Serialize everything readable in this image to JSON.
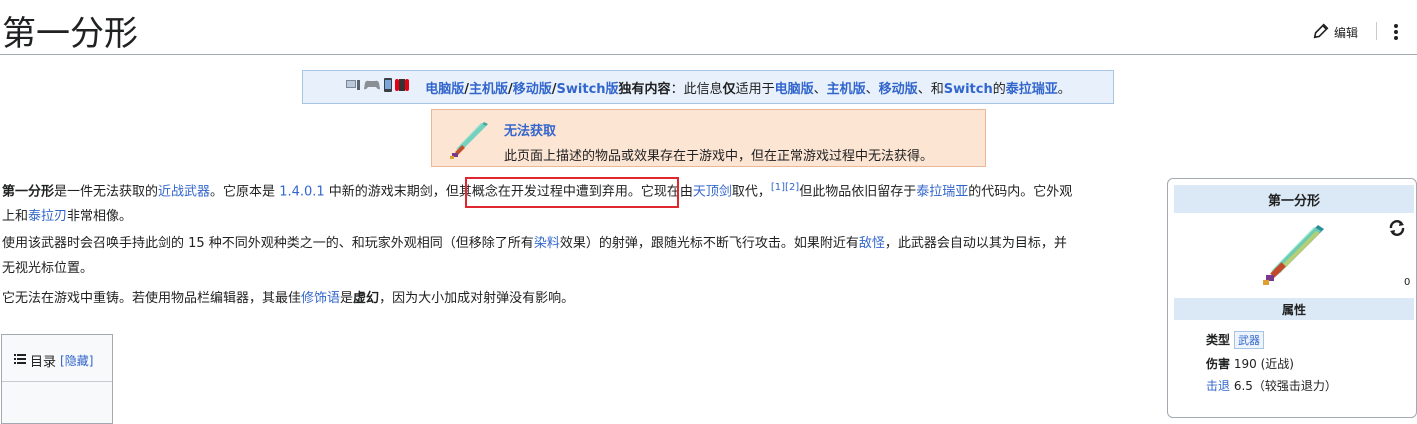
{
  "page": {
    "title": "第一分形",
    "edit_label": "编辑"
  },
  "platform_notice": {
    "pc": "电脑版",
    "console": "主机版",
    "mobile": "移动版",
    "switch": "Switch版",
    "exclusive": "独有内容",
    "text_a": "：此信息",
    "only": "仅",
    "text_b": "适用于",
    "pc2": "电脑版",
    "c2": "、",
    "console2": "主机版",
    "c3": "、",
    "mobile2": "移动版",
    "c4": "、和",
    "switch2": "Switch",
    "of": "的",
    "game": "泰拉瑞亚",
    "end": "。"
  },
  "unobtainable": {
    "heading": "无法获取",
    "text": "此页面上描述的物品或效果存在于游戏中，但在正常游戏过程中无法获得。"
  },
  "para1": {
    "bold": "第一分形",
    "a": "是一件无法获取的",
    "melee": "近战武器",
    "b": "。它原本是 ",
    "version": "1.4.0.1",
    "c": " 中新的游戏末期剑，",
    "highlight": "但其概念在开发过程中遭到弃用。",
    "d": "它现在由",
    "zenith": "天顶剑",
    "e": "取代，",
    "ref1": "[1]",
    "ref2": "[2]",
    "f": "但此物品依旧留存于",
    "terraria": "泰拉瑞亚",
    "g": "的代码内。它外观",
    "h": "上和",
    "terrablade": "泰拉刃",
    "i": "非常相像。"
  },
  "para2": {
    "a": "使用该武器时会召唤手持此剑的 15 种不同外观种类之一的、和玩家外观相同（但移除了所有",
    "dyes": "染料",
    "b": "效果）的射弹，跟随光标不断飞行攻击。如果附近有",
    "enemies": "敌怪",
    "c": "，此武器会自动以其为目标，并",
    "d": "无视光标位置。"
  },
  "para3": {
    "a": "它无法在游戏中重铸。若使用物品栏编辑器，其最佳",
    "modifier": "修饰语",
    "b": "是",
    "best": "虚幻",
    "c": "，因为大小加成对射弹没有影响。"
  },
  "toc": {
    "label": "目录",
    "hide": "[隐藏]"
  },
  "infobox": {
    "title": "第一分形",
    "small": "0",
    "section": "属性",
    "type_label": "类型",
    "type_value": "武器",
    "damage_label": "伤害",
    "damage_value": "190 (近战)",
    "knockback_label": "击退",
    "knockback_value": "6.5（较强击退力）"
  },
  "colors": {
    "link": "#3366cc",
    "highlight_box": "#e0262f",
    "platform_bg": "#e8f1fb",
    "unobtain_bg": "#fde5d4",
    "infobox_header": "#dbe9f6"
  },
  "icons": [
    "pencil-icon",
    "more-vertical-icon",
    "pc-icon",
    "controller-icon",
    "phone-icon",
    "switch-icon",
    "sword-icon",
    "refresh-icon",
    "list-icon"
  ]
}
